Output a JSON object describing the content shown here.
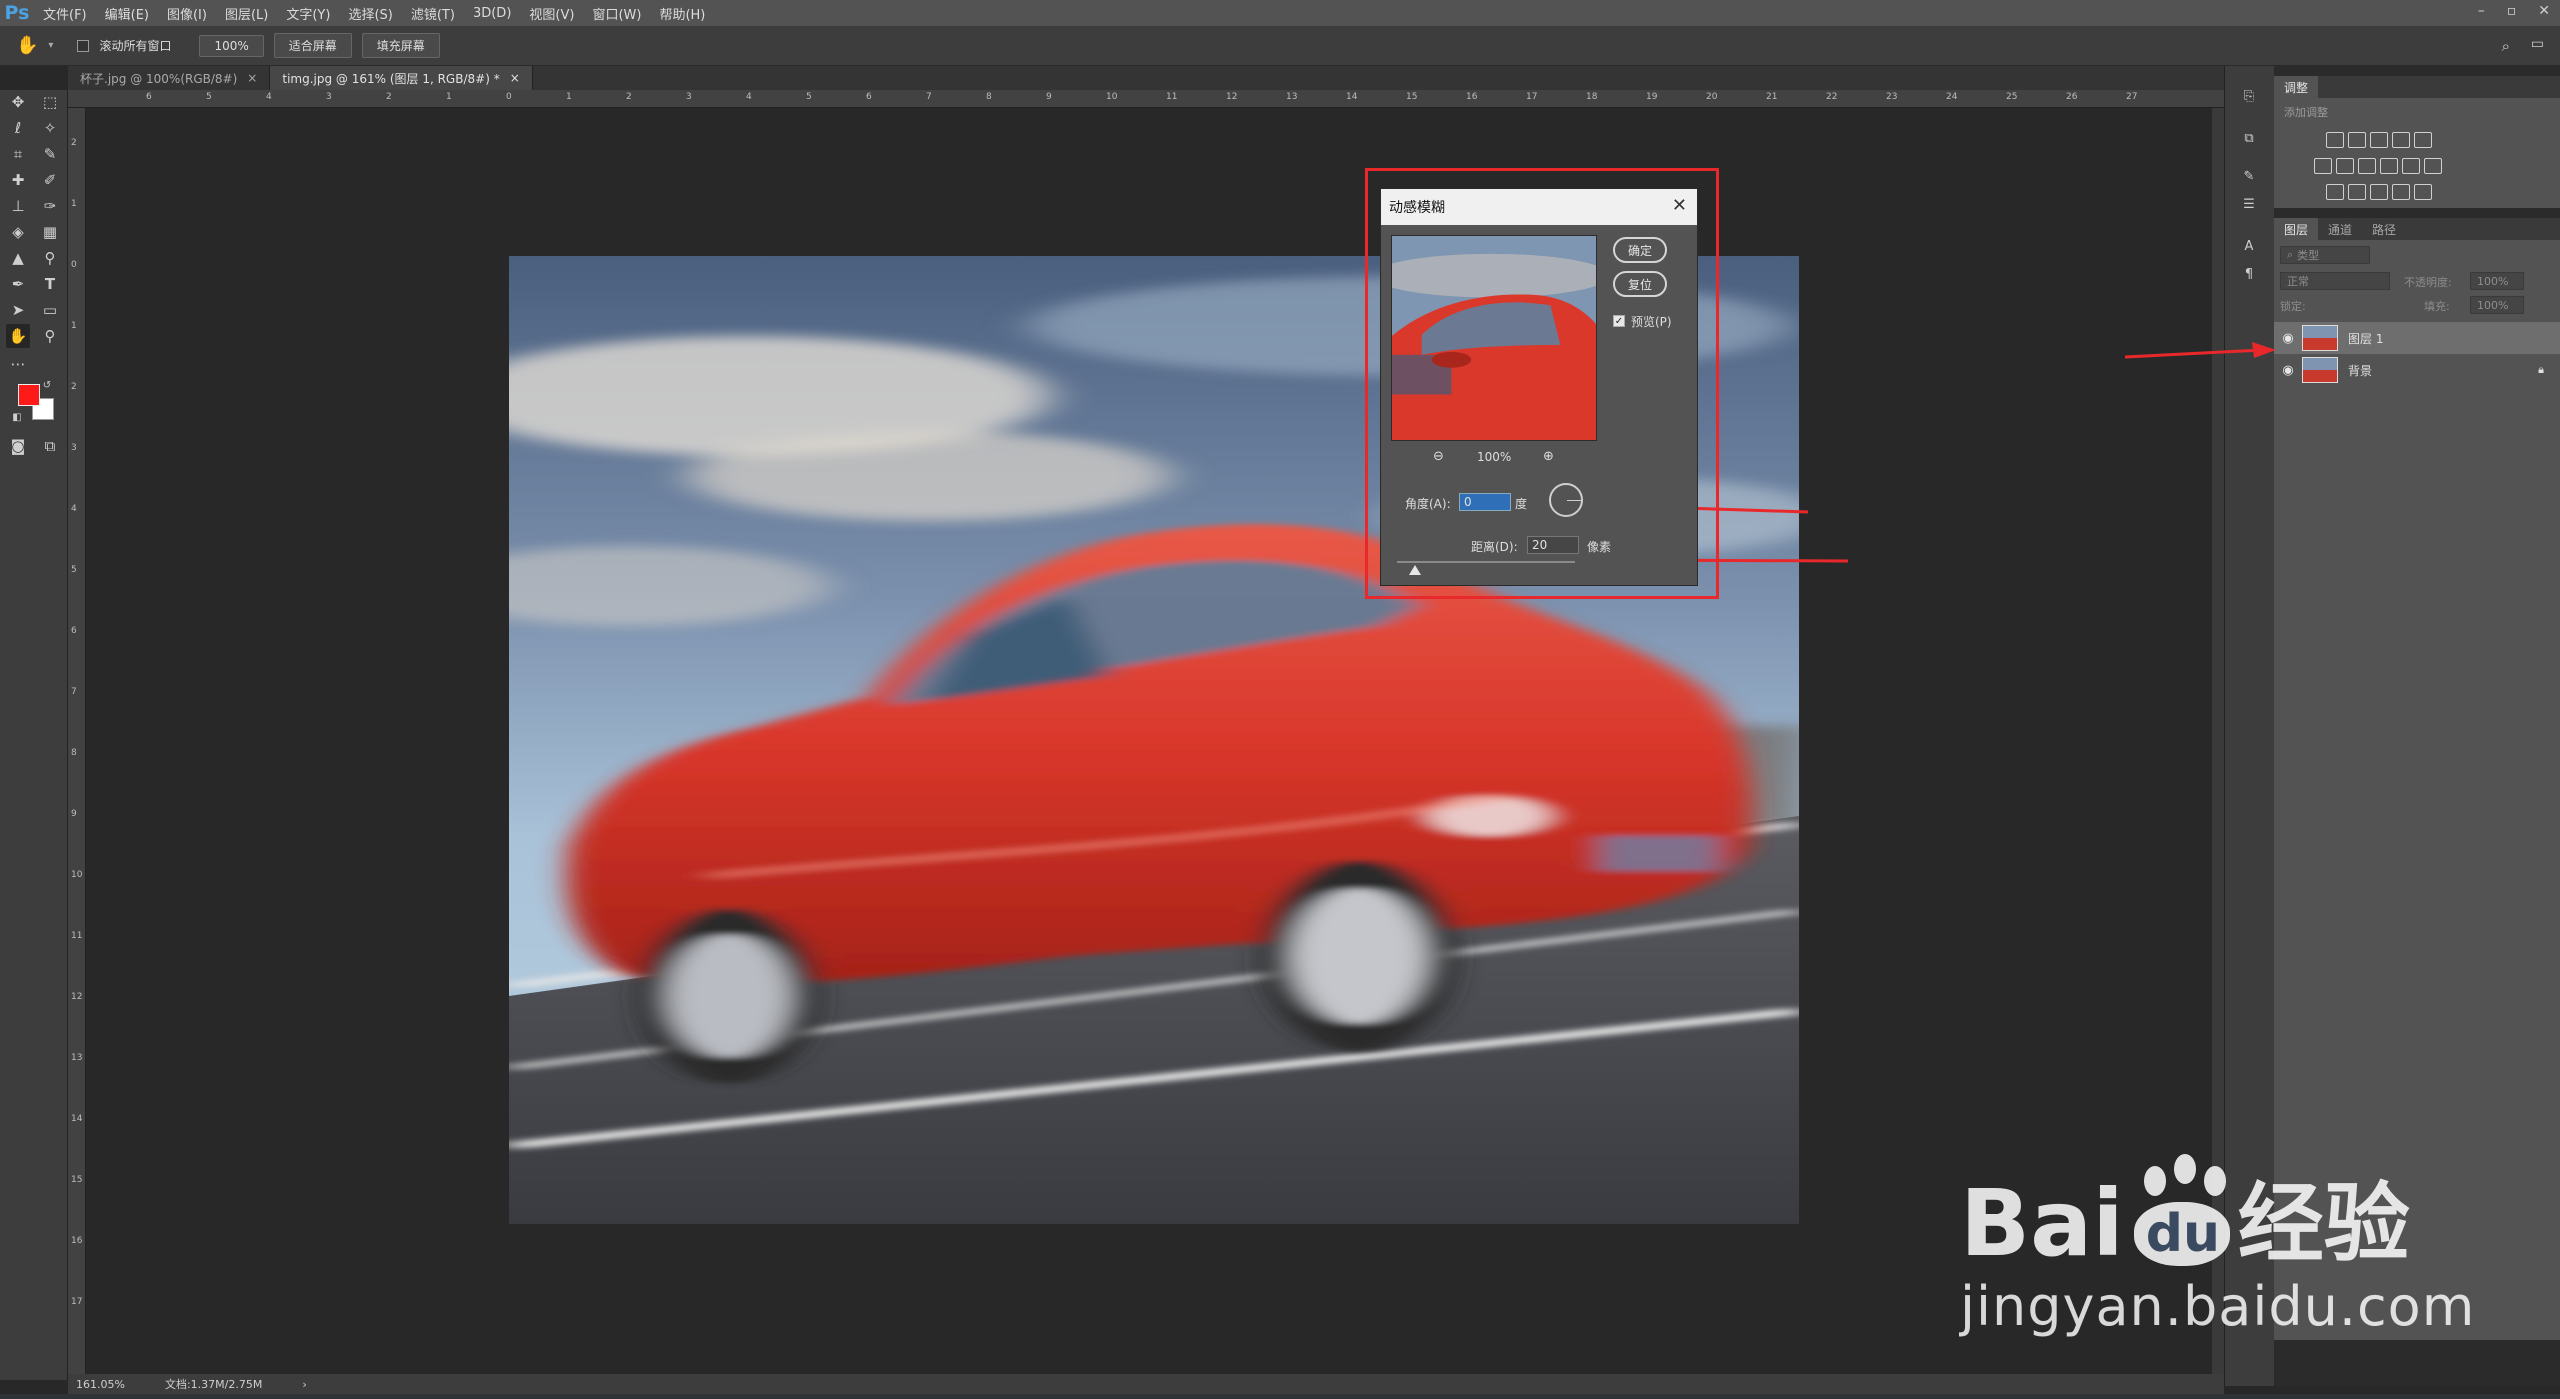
{
  "app": {
    "logo": "Ps",
    "menu": [
      "文件(F)",
      "编辑(E)",
      "图像(I)",
      "图层(L)",
      "文字(Y)",
      "选择(S)",
      "滤镜(T)",
      "3D(D)",
      "视图(V)",
      "窗口(W)",
      "帮助(H)"
    ],
    "window_controls": [
      "–",
      "▫",
      "✕"
    ]
  },
  "options": {
    "scroll_all_label": "滚动所有窗口",
    "zoom_button": "100%",
    "fit_screen_button": "适合屏幕",
    "fill_screen_button": "填充屏幕"
  },
  "tabs": [
    {
      "label": "杯子.jpg @ 100%(RGB/8#)",
      "close": "×"
    },
    {
      "label": "timg.jpg @ 161% (图层 1, RGB/8#) *",
      "close": "×"
    }
  ],
  "ruler_top_labels": [
    "6",
    "5",
    "4",
    "3",
    "2",
    "1",
    "0",
    "1",
    "2",
    "3",
    "4",
    "5",
    "6",
    "7",
    "8",
    "9",
    "10",
    "11",
    "12",
    "13",
    "14",
    "15",
    "16",
    "17",
    "18",
    "19",
    "20",
    "21",
    "22",
    "23",
    "24",
    "25",
    "26",
    "27"
  ],
  "ruler_left_labels": [
    "2",
    "1",
    "0",
    "1",
    "2",
    "3",
    "4",
    "5",
    "6",
    "7",
    "8",
    "9",
    "10",
    "11",
    "12",
    "13",
    "14",
    "15",
    "16",
    "17"
  ],
  "status": {
    "zoom": "161.05%",
    "doc": "文档:1.37M/2.75M",
    "arrow": "›"
  },
  "dialog": {
    "title": "动感模糊",
    "close": "✕",
    "ok_button": "确定",
    "reset_button": "复位",
    "preview_label": "预览(P)",
    "preview_checked": true,
    "zoom_value": "100%",
    "angle_label": "角度(A):",
    "angle_value": "0",
    "angle_unit": "度",
    "distance_label": "距离(D):",
    "distance_value": "20",
    "distance_unit": "像素"
  },
  "panels": {
    "adjustments_tab": "调整",
    "adjustments_title": "添加调整",
    "layers_tabs": [
      "图层",
      "通道",
      "路径"
    ],
    "kind_filter": "类型",
    "blend_mode": "正常",
    "opacity_label": "不透明度:",
    "opacity_value": "100%",
    "lock_label": "锁定:",
    "fill_label": "填充:",
    "fill_value": "100%",
    "layers": [
      {
        "name": "图层 1",
        "active": true,
        "locked": false
      },
      {
        "name": "背景",
        "active": false,
        "locked": true
      }
    ]
  },
  "watermark": {
    "brand_left": "Bai",
    "brand_paw": "du",
    "brand_cn": "经验",
    "url": "jingyan.baidu.com"
  },
  "accent": {
    "red_annotation": "#e8282b",
    "foreground_color": "#ff1a1a",
    "background_color": "#ffffff"
  }
}
